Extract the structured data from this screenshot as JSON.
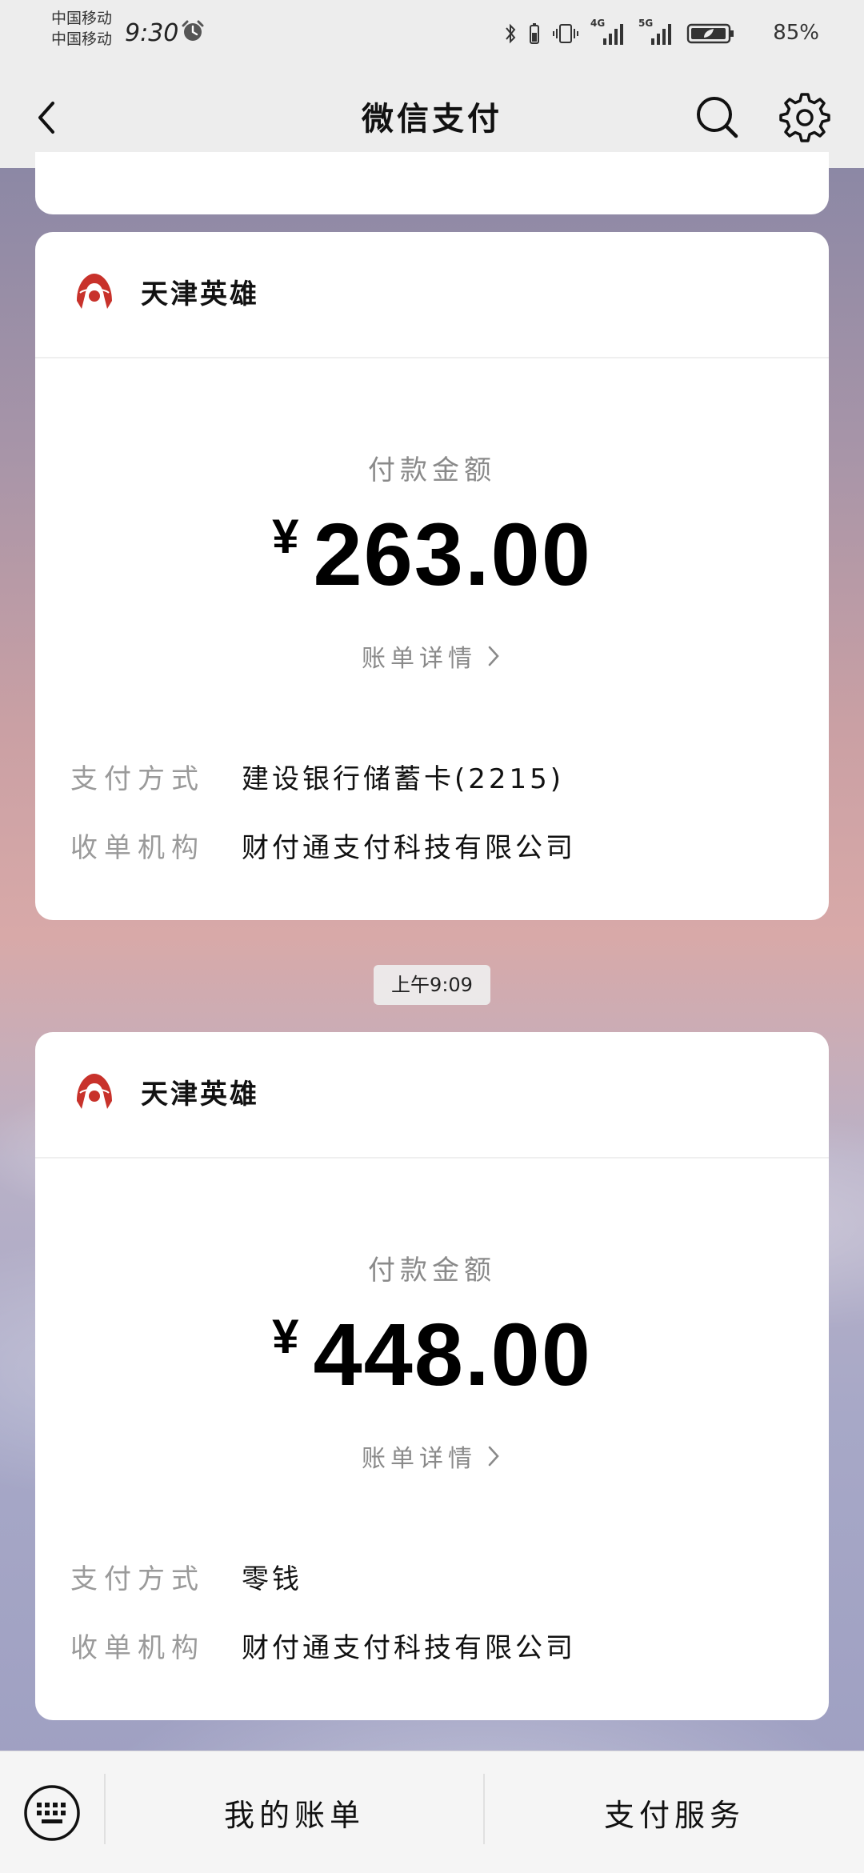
{
  "status_bar": {
    "carrier_1": "中国移动",
    "carrier_2": "中国移动",
    "time": "9:30",
    "battery_percent": "85%",
    "signal_1_label": "4G",
    "signal_2_label": "5G"
  },
  "nav": {
    "title": "微信支付"
  },
  "payments": [
    {
      "merchant": "天津英雄",
      "amount_label": "付款金额",
      "currency": "¥",
      "amount": "263.00",
      "bill_link": "账单详情",
      "method_label": "支付方式",
      "method_value": "建设银行储蓄卡(2215)",
      "acquirer_label": "收单机构",
      "acquirer_value": "财付通支付科技有限公司"
    },
    {
      "merchant": "天津英雄",
      "amount_label": "付款金额",
      "currency": "¥",
      "amount": "448.00",
      "bill_link": "账单详情",
      "method_label": "支付方式",
      "method_value": "零钱",
      "acquirer_label": "收单机构",
      "acquirer_value": "财付通支付科技有限公司"
    }
  ],
  "timestamp": "上午9:09",
  "bottom_bar": {
    "tab_bills": "我的账单",
    "tab_services": "支付服务"
  },
  "colors": {
    "logo_red": "#c8322b",
    "nav_bg": "#ededed"
  },
  "icons": [
    "back-icon",
    "search-icon",
    "gear-icon",
    "alarm-icon",
    "keyboard-icon",
    "chevron-right-icon",
    "merchant-logo-icon"
  ]
}
